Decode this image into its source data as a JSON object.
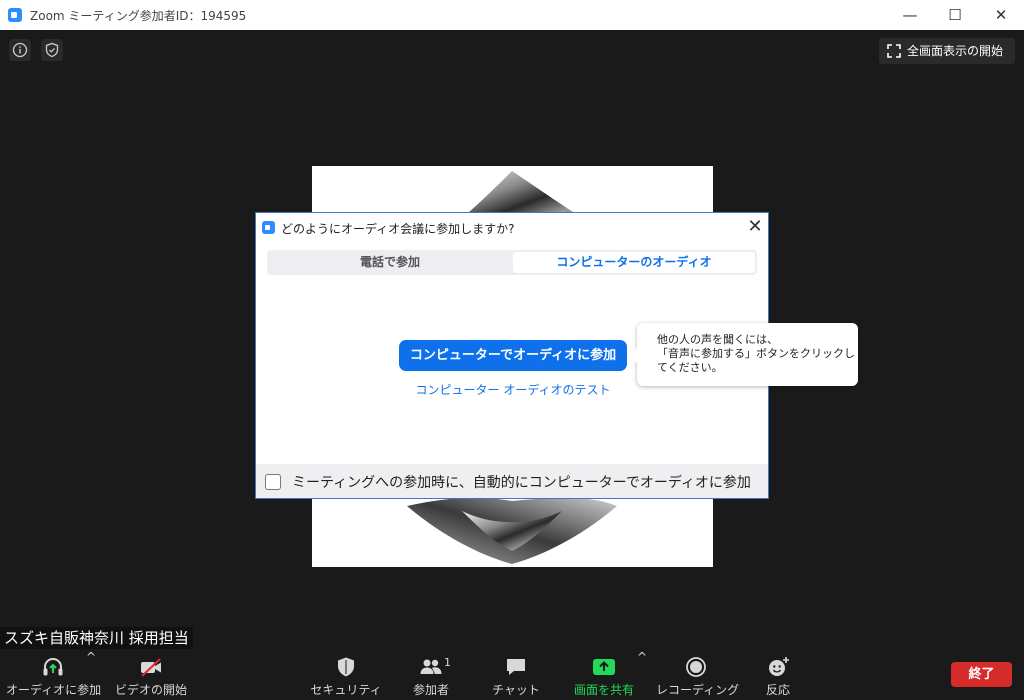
{
  "window": {
    "title": "Zoom ミーティング参加者ID：194595",
    "minimize_glyph": "—",
    "maximize_glyph": "☐",
    "close_glyph": "✕"
  },
  "top_bar": {
    "icons": [
      "info-icon",
      "shield-icon"
    ],
    "fullscreen_label": "全画面表示の開始"
  },
  "participant": {
    "name": "スズキ自販神奈川 採用担当"
  },
  "dialog": {
    "title": "どのようにオーディオ会議に参加しますか?",
    "close_glyph": "✕",
    "tabs": [
      {
        "label": "電話で参加",
        "active": false
      },
      {
        "label": "コンピューターのオーディオ",
        "active": true
      }
    ],
    "join_button": "コンピューターでオーディオに参加",
    "test_link": "コンピューター オーディオのテスト",
    "auto_join_label": "ミーティングへの参加時に、自動的にコンピューターでオーディオに参加",
    "auto_join_checked": false
  },
  "tooltip": {
    "line1": "他の人の声を聞くには、",
    "line2": "「音声に参加する」ボタンをクリックし",
    "line3": "てください。"
  },
  "toolbar": {
    "items": [
      {
        "label": "オーディオに参加",
        "icon": "headphones-icon"
      },
      {
        "label": "ビデオの開始",
        "icon": "video-off-icon"
      },
      {
        "label": "セキュリティ",
        "icon": "shield-icon"
      },
      {
        "label": "参加者",
        "icon": "participants-icon",
        "count": "1"
      },
      {
        "label": "チャット",
        "icon": "chat-icon"
      },
      {
        "label": "画面を共有",
        "icon": "share-screen-icon"
      },
      {
        "label": "レコーディング",
        "icon": "record-icon"
      },
      {
        "label": "反応",
        "icon": "reaction-icon"
      }
    ],
    "caret_glyph": "^",
    "end_label": "終了"
  },
  "colors": {
    "accent": "#0e71eb",
    "share_green": "#23d959",
    "end_red": "#d62b2b",
    "background": "#1a1a1a"
  }
}
